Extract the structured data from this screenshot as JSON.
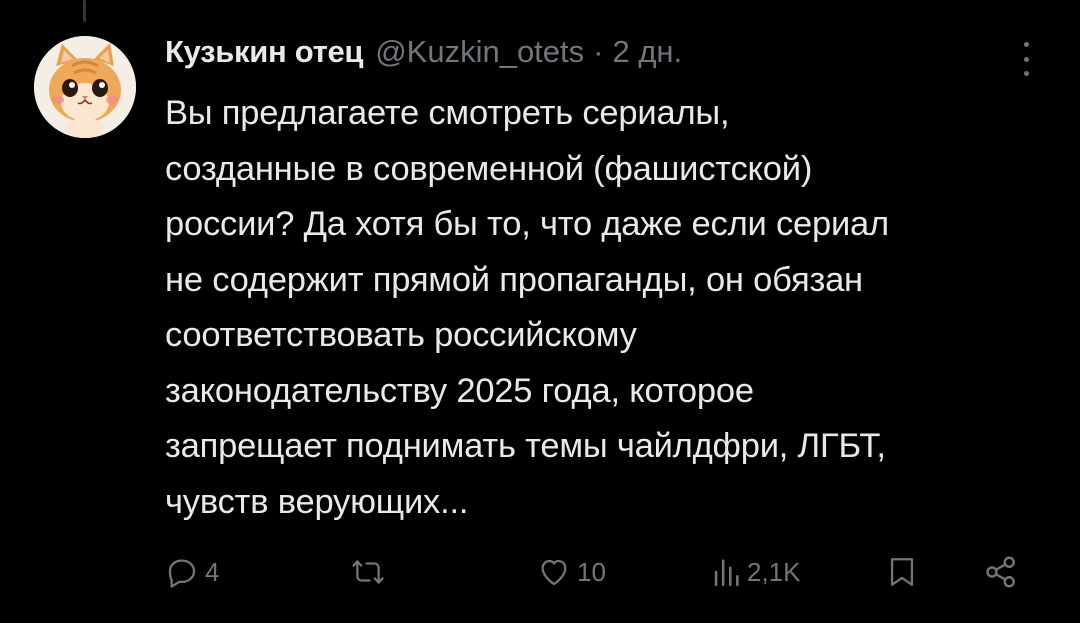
{
  "tweet": {
    "name": "Кузькин отец",
    "handle": "@Kuzkin_otets",
    "separator": "·",
    "time": "2 дн.",
    "text": "Вы предлагаете смотреть сериалы,\nсозданные в современной (фашистской)\nроссии? Да хотя бы то, что даже если сериал\nне содержит прямой пропаганды, он обязан\nсоответствовать российскому\nзаконодательству 2025 года, которое\nзапрещает поднимать темы чайлдфри, ЛГБТ,\nчувств верующих..."
  },
  "actions": {
    "replies": "4",
    "likes": "10",
    "views": "2,1K"
  },
  "icons": {
    "avatar": "kitten-avatar",
    "more": "more-vertical-icon",
    "reply": "reply-icon",
    "repost": "repost-icon",
    "like": "heart-icon",
    "views": "views-icon",
    "bookmark": "bookmark-icon",
    "share": "share-icon"
  },
  "colors": {
    "background": "#000000",
    "text": "#e7e9ea",
    "secondary": "#71767b"
  }
}
